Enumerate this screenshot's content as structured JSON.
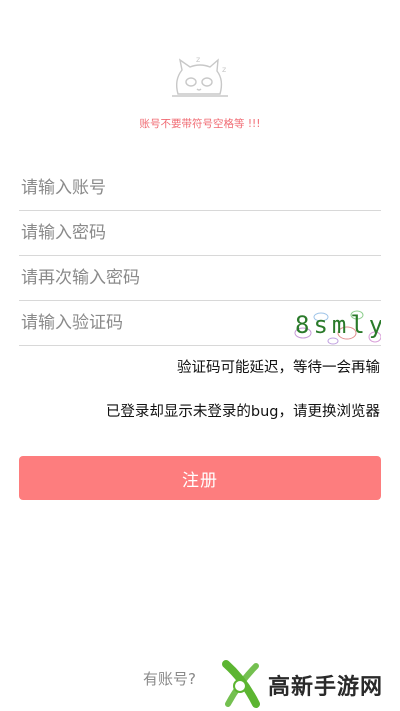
{
  "hint": "账号不要带符号空格等 !!!",
  "form": {
    "account_placeholder": "请输入账号",
    "password_placeholder": "请输入密码",
    "confirm_placeholder": "请再次输入密码",
    "captcha_placeholder": "请输入验证码",
    "captcha_text": "8smly"
  },
  "notes": {
    "captcha_delay": "验证码可能延迟，等待一会再输",
    "bug_notice": "已登录却显示未登录的bug，请更换浏览器"
  },
  "register_label": "注册",
  "have_account": "有账号?",
  "watermark": "高新手游网",
  "colors": {
    "accent": "#fd7d7e",
    "hint": "#f06a72",
    "watermark_green": "#5cb531"
  }
}
